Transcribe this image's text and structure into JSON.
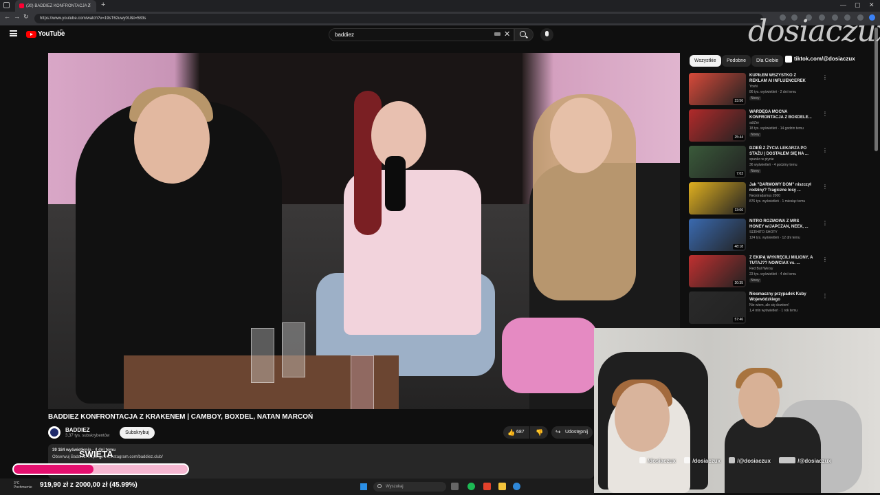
{
  "browser": {
    "tab_title": "(30) BADDIEZ KONFRONTACJA Z",
    "tab_close": "×",
    "new_tab": "+",
    "url": "https://www.youtube.com/watch?v=19sT62uwy0U&t=583s",
    "window_controls": [
      "—",
      "▢",
      "✕"
    ],
    "nav": [
      "←",
      "→",
      "↻"
    ]
  },
  "youtube": {
    "logo_text": "YouTube",
    "country": "PL",
    "search_query": "baddiez",
    "clear": "✕"
  },
  "video": {
    "title": "BADDIEZ KONFRONTACJA Z KRAKENEM | CAMBOY, BOXDEL, NATAN MARCOŃ",
    "channel_name": "BADDIEZ",
    "channel_subs": "3,37 tys. subskrybentów",
    "subscribe_label": "Subskrybuj",
    "like_count": "687",
    "like_icon": "👍",
    "dislike_icon": "👎",
    "share_label": "Udostępnij",
    "share_icon": "↪",
    "desc_views": "39 184 wyświetlenia · 4 dni temu",
    "desc_text": "Obserwuj Baddiez: https://www.instagram.com/baddiez.club/"
  },
  "chips": [
    "Wszystkie",
    "Podobne",
    "Dla Ciebie"
  ],
  "recommendations": [
    {
      "title": "KUPIŁEM WSZYSTKO Z REKLAM AI INFLUENCEREK",
      "channel": "Yoshi",
      "meta": "86 tys. wyświetleń · 2 dni temu",
      "badge": "Nowy",
      "duration": "23:56",
      "color": "#d84a3a"
    },
    {
      "title": "WARDĘGA MOCNA KONFRONTACJA Z BOXDELE...",
      "channel": "adiZer",
      "meta": "18 tys. wyświetleń · 14 godzin temu",
      "badge": "Nowy",
      "duration": "25:44",
      "color": "#b22a2a"
    },
    {
      "title": "DZIEŃ Z ŻYCIA LEKARZA PO STAŻU | DOSTAŁEM SIĘ NA ...",
      "channel": "spanko w piynie",
      "meta": "36 wyświetleń · 4 godziny temu",
      "badge": "Nowy",
      "duration": "7:03",
      "color": "#3a5a3a"
    },
    {
      "title": "Jak \"DARMOWY DOM\" niszczył rodziny? Tragiczne losy ...",
      "channel": "Neostradamus 2000",
      "meta": "876 tys. wyświetleń · 1 miesiąc temu",
      "badge": "",
      "duration": "13:06",
      "color": "#e0b020"
    },
    {
      "title": "NITRO ROZMOWA Z MRS HONEY w/JAPCZAN, NEEX, ...",
      "channel": "SERHITO SHOTY",
      "meta": "124 tys. wyświetleń · 12 dni temu",
      "badge": "",
      "duration": "48:18",
      "color": "#3a6ab0"
    },
    {
      "title": "Z EKIPĄ WYKRĘCILI MILIONY, A TUTAJ?? NOWCIAX vs. ...",
      "channel": "Red Bull Wersy",
      "meta": "23 tys. wyświetleń · 4 dni temu",
      "badge": "Nowy",
      "duration": "20:35",
      "color": "#c03030"
    },
    {
      "title": "Niesmaczny przypadek Kuby Wojewódzkiego",
      "channel": "Nie wiem, ale się dowiem!",
      "meta": "1,4 mln wyświetleń · 1 rok temu",
      "badge": "",
      "duration": "57:46",
      "color": "#2a2a2a"
    }
  ],
  "overlay": {
    "brand": "dosiaczux",
    "tiktok": "tiktok.com/@dosiaczux",
    "socials": [
      "/dosiaczux",
      "/dosiaczux",
      "/@dosiaczux",
      "/@dosiaczux"
    ],
    "goal_label": "ŚWIĘTA",
    "goal_amount": "919,90 zł z 2000,00 zł (45.99%)",
    "goal_fraction": 0.4599
  },
  "taskbar": {
    "weather": [
      "3°C",
      "Pochmurnie"
    ],
    "search_placeholder": "Wyszukaj"
  }
}
